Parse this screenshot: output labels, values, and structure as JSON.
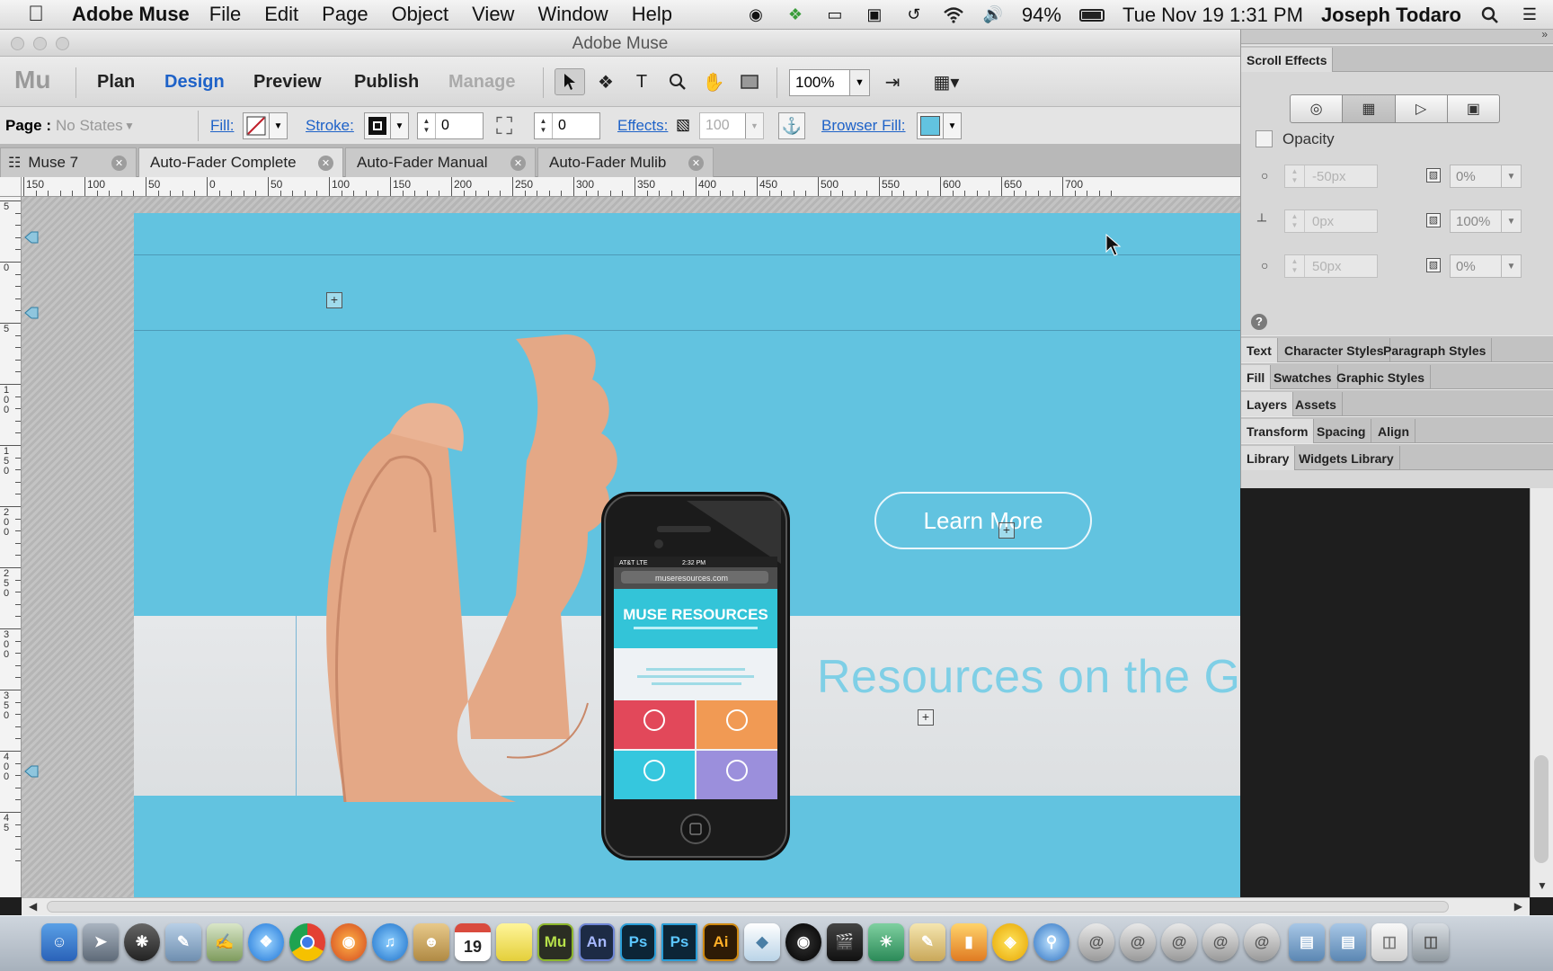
{
  "menubar": {
    "app_name": "Adobe Muse",
    "items": [
      "File",
      "Edit",
      "Page",
      "Object",
      "View",
      "Window",
      "Help"
    ],
    "battery": "94%",
    "datetime": "Tue Nov 19  1:31 PM",
    "user": "Joseph Todaro"
  },
  "window": {
    "title": "Adobe Muse"
  },
  "modes": {
    "logo": "Mu",
    "plan": "Plan",
    "design": "Design",
    "preview": "Preview",
    "publish": "Publish",
    "manage": "Manage",
    "zoom": "100%"
  },
  "controlbar": {
    "page_label": "Page :",
    "page_state": "No States",
    "fill_label": "Fill:",
    "stroke_label": "Stroke:",
    "stroke_value": "0",
    "corner_value": "0",
    "effects_label": "Effects:",
    "effects_value": "100",
    "browser_fill_label": "Browser Fill:",
    "browser_fill_color": "#62c3e0"
  },
  "tabs": [
    {
      "label": "Muse 7"
    },
    {
      "label": "Auto-Fader Complete"
    },
    {
      "label": "Auto-Fader Manual"
    },
    {
      "label": "Auto-Fader Mulib"
    }
  ],
  "ruler": {
    "h_labels": [
      "150",
      "100",
      "50",
      "0",
      "50",
      "100",
      "150",
      "200",
      "250",
      "300",
      "350",
      "400",
      "450",
      "500",
      "550",
      "600",
      "650",
      "700"
    ],
    "v_labels": [
      "5",
      "0",
      "5",
      "1 0 0",
      "1 5 0",
      "2 0 0",
      "2 5 0",
      "3 0 0",
      "3 5 0",
      "4 0 0",
      "4 5"
    ]
  },
  "canvas": {
    "learn_more": "Learn More",
    "headline": "Resources on the Go",
    "phone_brand": "MUSE RESOURCES",
    "phone_url": "museresources.com",
    "phone_carrier": "AT&T  LTE",
    "phone_time": "2:32 PM"
  },
  "panel": {
    "title": "Scroll Effects",
    "opacity_label": "Opacity",
    "rows": [
      {
        "pos": "-50px",
        "pct": "0%"
      },
      {
        "pos": "0px",
        "pct": "100%"
      },
      {
        "pos": "50px",
        "pct": "0%"
      }
    ],
    "help": "?",
    "tab_groups": [
      [
        "Text",
        "Character Styles",
        "Paragraph Styles"
      ],
      [
        "Fill",
        "Swatches",
        "Graphic Styles"
      ],
      [
        "Layers",
        "Assets"
      ],
      [
        "Transform",
        "Spacing",
        "Align"
      ],
      [
        "Library",
        "Widgets Library"
      ]
    ]
  },
  "dock": {
    "labels": [
      "Mu",
      "An",
      "Ps",
      "Ps",
      "Ai"
    ],
    "calendar_day": "19"
  }
}
